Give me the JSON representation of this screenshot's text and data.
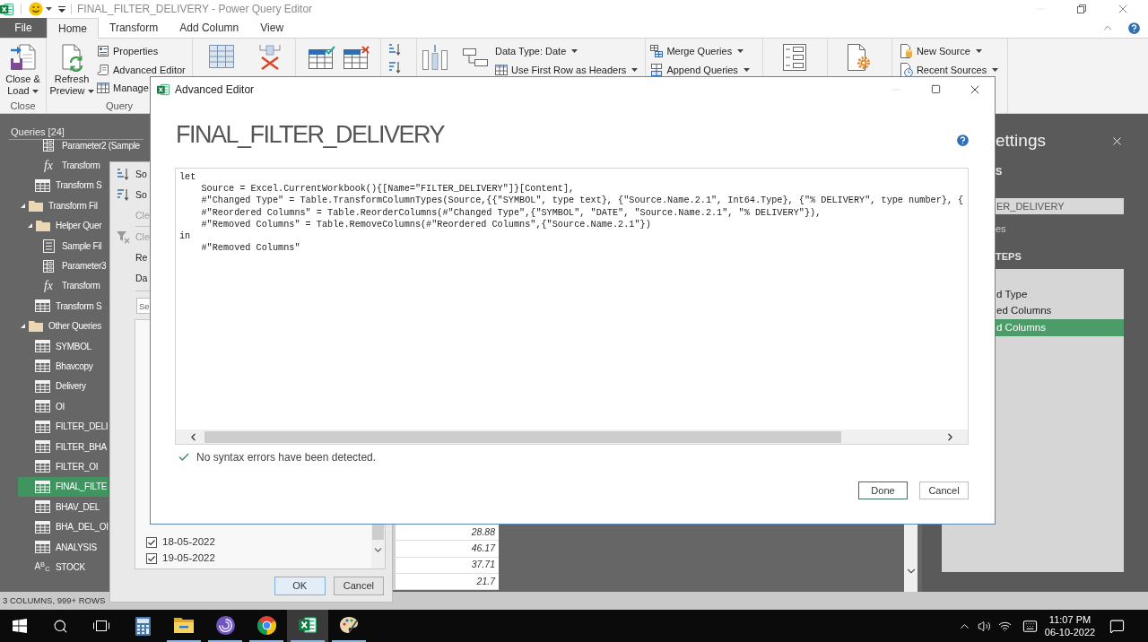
{
  "title_bar": {
    "title": "FINAL_FILTER_DELIVERY - Power Query Editor"
  },
  "ribbon": {
    "tabs": [
      {
        "label": "File",
        "kind": "file",
        "selected": false
      },
      {
        "label": "Home",
        "kind": "tab",
        "selected": true
      },
      {
        "label": "Transform",
        "kind": "tab",
        "selected": false
      },
      {
        "label": "Add Column",
        "kind": "tab",
        "selected": false
      },
      {
        "label": "View",
        "kind": "tab",
        "selected": false
      }
    ],
    "close_group": {
      "button": "Close & Load",
      "label": "Close"
    },
    "query_group": {
      "button": "Refresh Preview",
      "items": [
        "Properties",
        "Advanced Editor",
        "Manage"
      ],
      "label": "Query"
    },
    "transform_group": {
      "items": [
        "Data Type: Date",
        "Use First Row as Headers"
      ]
    },
    "combine_group": {
      "items": [
        "Merge Queries",
        "Append Queries"
      ]
    },
    "new_query_group": {
      "items": [
        "New Source",
        "Recent Sources"
      ]
    }
  },
  "queries_pane": {
    "title": "Queries [24]",
    "items": [
      {
        "kind": "continued",
        "children": [
          {
            "kind": "continued",
            "children": [
              {
                "kind": "parameter",
                "label": "Parameter2 (Sample",
                "selected": false
              },
              {
                "kind": "function",
                "symbol": "fx",
                "label": "Transform",
                "selected": false
              }
            ]
          },
          {
            "kind": "table",
            "label": "Transform S",
            "selected": false
          }
        ]
      },
      {
        "kind": "folder",
        "label": "Transform Fil",
        "expanded": true,
        "selected": false,
        "children": [
          {
            "kind": "folder",
            "label": "Helper Quer",
            "expanded": true,
            "selected": false,
            "children": [
              {
                "kind": "file",
                "label": "Sample Fil",
                "selected": false
              },
              {
                "kind": "parameter",
                "label": "Parameter3",
                "selected": false
              },
              {
                "kind": "function",
                "symbol": "fx",
                "label": "Transform",
                "selected": false
              }
            ]
          },
          {
            "kind": "table",
            "label": "Transform S",
            "selected": false
          }
        ]
      },
      {
        "kind": "folder",
        "label": "Other Queries",
        "expanded": true,
        "selected": false,
        "children": [
          {
            "kind": "table",
            "label": "SYMBOL",
            "selected": false
          },
          {
            "kind": "table",
            "label": "Bhavcopy",
            "selected": false
          },
          {
            "kind": "table",
            "label": "Delivery",
            "selected": false
          },
          {
            "kind": "table",
            "label": "OI",
            "selected": false
          },
          {
            "kind": "table",
            "label": "FILTER_DELI",
            "selected": false
          },
          {
            "kind": "table",
            "label": "FILTER_BHA",
            "selected": false
          },
          {
            "kind": "table",
            "label": "FILTER_OI",
            "selected": false
          },
          {
            "kind": "table",
            "label": "FINAL_FILTE",
            "selected": true
          },
          {
            "kind": "table",
            "label": "BHAV_DEL",
            "selected": false
          },
          {
            "kind": "table",
            "label": "BHA_DEL_OI",
            "selected": false
          },
          {
            "kind": "table",
            "label": "ANALYSIS",
            "selected": false
          },
          {
            "kind": "text",
            "symbol": "A$^{B}$$_{C}$",
            "label": "STOCK",
            "selected": false
          }
        ]
      }
    ]
  },
  "filter_menu": {
    "sections": [
      [
        {
          "kind": "sort_ascending",
          "label": "So",
          "disabled": false
        },
        {
          "kind": "sort_descending",
          "label": "So",
          "disabled": false
        },
        {
          "kind": "plain",
          "label": "Cle",
          "disabled": true
        }
      ],
      [
        {
          "kind": "clear_filter",
          "label": "Cle",
          "disabled": true
        },
        {
          "kind": "plain",
          "label": "Re",
          "disabled": false
        },
        {
          "kind": "plain",
          "label": "Da",
          "disabled": false
        }
      ]
    ],
    "search": {
      "placeholder": "Se"
    },
    "values": [
      {
        "label": "18-05-2022",
        "checked": true
      },
      {
        "label": "19-05-2022",
        "checked": true
      }
    ],
    "buttons": [
      {
        "label": "OK",
        "default": true
      },
      {
        "label": "Cancel",
        "default": false
      }
    ]
  },
  "data_grid": {
    "cells": [
      "28.88",
      "46.17",
      "37.71",
      "21.7"
    ]
  },
  "query_settings": {
    "title": "ettings",
    "properties_heading": "S",
    "name_value": "ER_DELIVERY",
    "all_properties_link": "es",
    "steps_heading": "TEPS",
    "steps": [
      {
        "label": "d Type",
        "selected": false
      },
      {
        "label": "ed Columns",
        "selected": false
      },
      {
        "label": "d Columns",
        "selected": true
      }
    ]
  },
  "status_bar": {
    "text": "3 COLUMNS, 999+ ROWS"
  },
  "advanced_editor": {
    "title": "Advanced Editor",
    "heading": "FINAL_FILTER_DELIVERY",
    "code_lines": [
      "let",
      "    Source = Excel.CurrentWorkbook(){[Name=\"FILTER_DELIVERY\"]}[Content],",
      "    #\"Changed Type\" = Table.TransformColumnTypes(Source,{{\"SYMBOL\", type text}, {\"Source.Name.2.1\", Int64.Type}, {\"% DELIVERY\", type number}, {",
      "    #\"Reordered Columns\" = Table.ReorderColumns(#\"Changed Type\",{\"SYMBOL\", \"DATE\", \"Source.Name.2.1\", \"% DELIVERY\"}),",
      "    #\"Removed Columns\" = Table.RemoveColumns(#\"Reordered Columns\",{\"Source.Name.2.1\"})",
      "in",
      "    #\"Removed Columns\""
    ],
    "status": "No syntax errors have been detected.",
    "buttons": [
      {
        "label": "Done",
        "default": true
      },
      {
        "label": "Cancel",
        "default": false
      }
    ]
  },
  "taskbar": {
    "apps": [
      {
        "kind": "calculator",
        "running": false,
        "active": false
      },
      {
        "kind": "file_explorer",
        "running": true,
        "active": false
      },
      {
        "kind": "swirl",
        "running": true,
        "active": false
      },
      {
        "kind": "browser",
        "running": true,
        "active": false
      },
      {
        "kind": "spreadsheet",
        "running": true,
        "active": true
      },
      {
        "kind": "paint",
        "running": true,
        "active": false
      }
    ],
    "time": "11:07 PM",
    "date": "06-10-2022"
  }
}
